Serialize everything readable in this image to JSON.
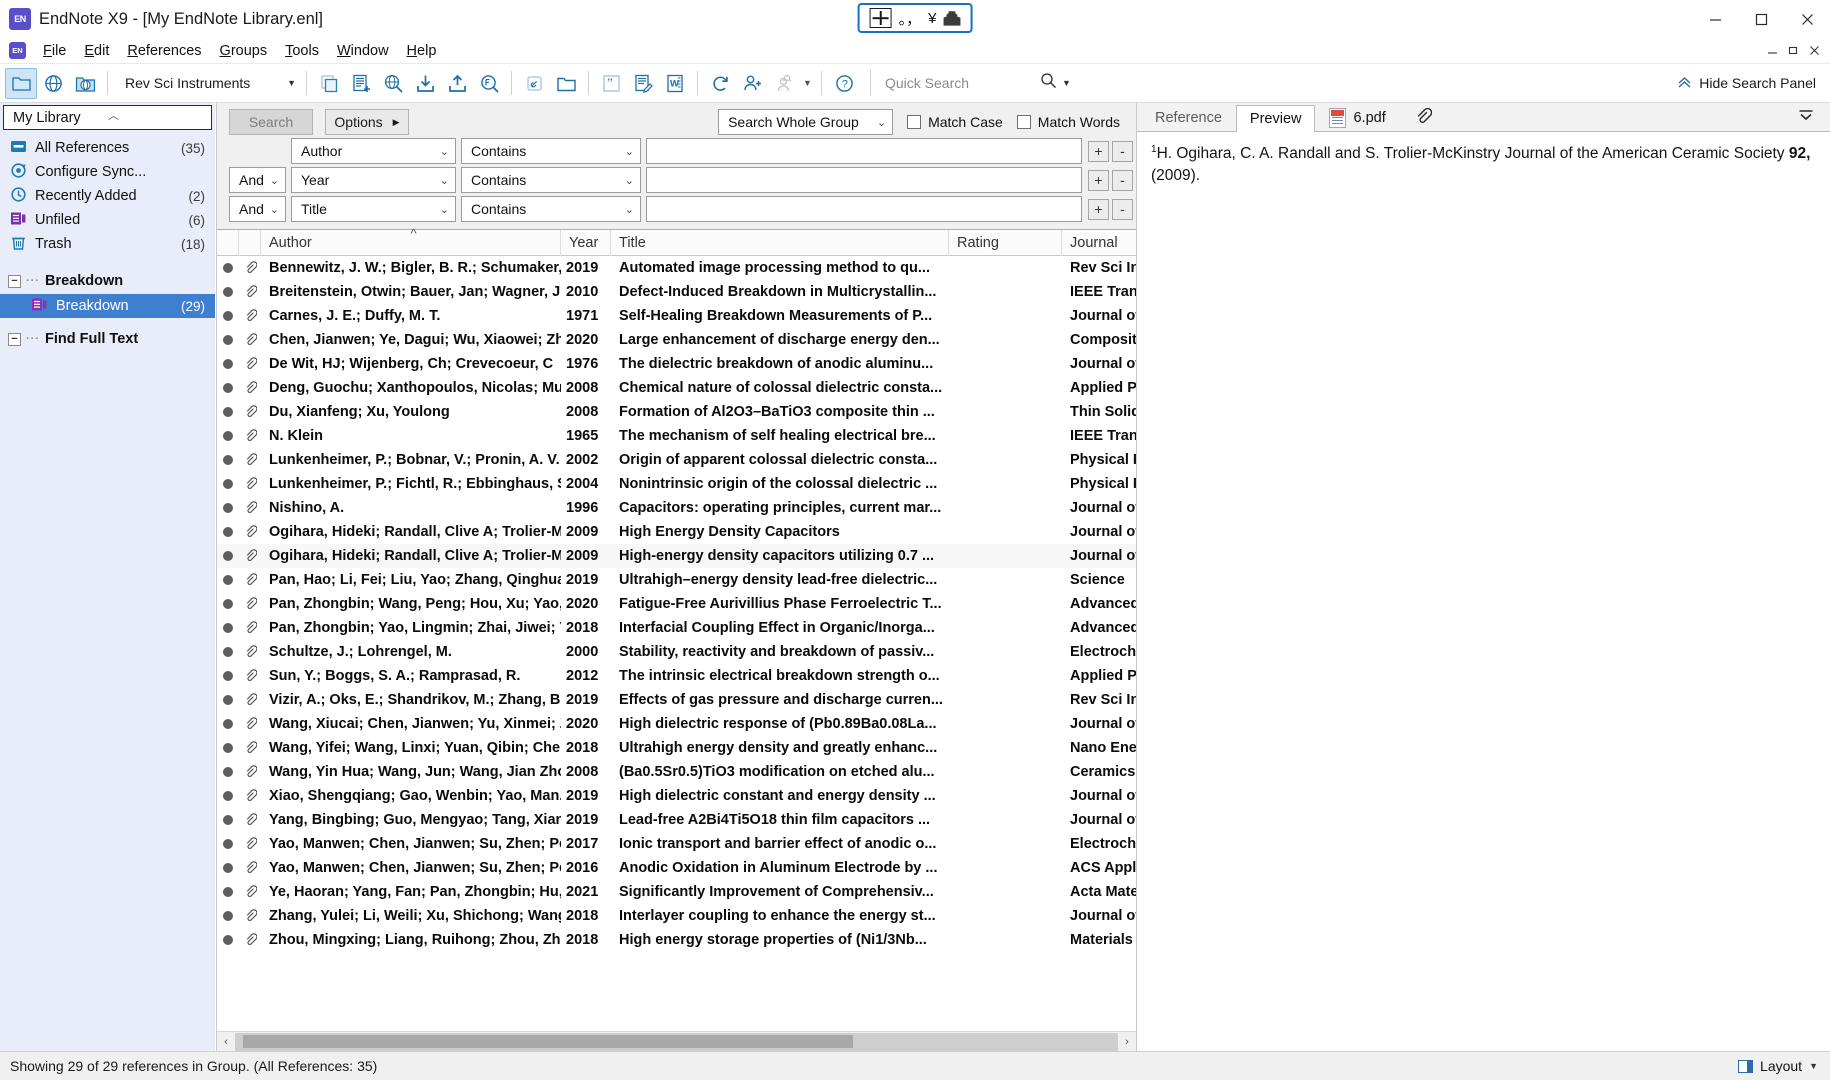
{
  "window": {
    "title": "EndNote X9 - [My EndNote Library.enl]",
    "app_badge": "EN",
    "minimize": "minimize",
    "maximize": "maximize",
    "close": "close"
  },
  "ime": {
    "lang": "中",
    "punct": "。，",
    "currency": "¥",
    "hat": "hat-icon"
  },
  "menu": {
    "items": [
      {
        "label": "File",
        "accel": "F"
      },
      {
        "label": "Edit",
        "accel": "E"
      },
      {
        "label": "References",
        "accel": "R"
      },
      {
        "label": "Groups",
        "accel": "G"
      },
      {
        "label": "Tools",
        "accel": "T"
      },
      {
        "label": "Window",
        "accel": "W"
      },
      {
        "label": "Help",
        "accel": "H"
      }
    ]
  },
  "toolbar": {
    "style_value": "Rev Sci Instruments",
    "quick_search_placeholder": "Quick Search",
    "hide_search_panel": "Hide Search Panel",
    "icons": [
      "new-folder-icon",
      "online-search-icon",
      "globe-folder-icon",
      "copy-icon",
      "new-reference-icon",
      "online-search-mode-icon",
      "import-icon",
      "export-icon",
      "find-full-text-icon",
      "link-icon",
      "open-file-icon",
      "quote-icon",
      "edit-reference-icon",
      "word-icon",
      "sync-icon",
      "share-icon",
      "activity-feed-icon",
      "help-icon"
    ]
  },
  "sidebar": {
    "library_label": "My Library",
    "items": [
      {
        "icon": "all-references-icon",
        "label": "All References",
        "count": "(35)"
      },
      {
        "icon": "configure-sync-icon",
        "label": "Configure Sync...",
        "count": ""
      },
      {
        "icon": "recently-added-icon",
        "label": "Recently Added",
        "count": "(2)"
      },
      {
        "icon": "unfiled-icon",
        "label": "Unfiled",
        "count": "(6)"
      },
      {
        "icon": "trash-icon",
        "label": "Trash",
        "count": "(18)"
      }
    ],
    "group_header": "Breakdown",
    "group_children": [
      {
        "icon": "group-icon",
        "label": "Breakdown",
        "count": "(29)",
        "selected": true
      }
    ],
    "find_full_text_header": "Find Full Text"
  },
  "search_panel": {
    "search_button": "Search",
    "options_button": "Options",
    "scope_value": "Search Whole Group",
    "match_case_label": "Match Case",
    "match_words_label": "Match Words",
    "match_case_checked": false,
    "match_words_checked": false,
    "rows": [
      {
        "conj": "",
        "field": "Author",
        "op": "Contains",
        "term": ""
      },
      {
        "conj": "And",
        "field": "Year",
        "op": "Contains",
        "term": ""
      },
      {
        "conj": "And",
        "field": "Title",
        "op": "Contains",
        "term": ""
      }
    ],
    "plus_label": "+",
    "minus_label": "-"
  },
  "table": {
    "columns": [
      "Author",
      "Year",
      "Title",
      "Rating",
      "Journal"
    ],
    "sorted_column": "Author",
    "rows": [
      {
        "author": "Bennewitz, J. W.; Bigler, B. R.; Schumaker, ...",
        "year": "2019",
        "title": "Automated image processing method to qu...",
        "rating": "",
        "journal": "Rev Sci Instrum"
      },
      {
        "author": "Breitenstein, Otwin; Bauer, Jan; Wagner, J...",
        "year": "2010",
        "title": "Defect-Induced Breakdown in Multicrystallin...",
        "rating": "",
        "journal": "IEEE Transactions on Elec"
      },
      {
        "author": "Carnes, J. E.; Duffy, M. T.",
        "year": "1971",
        "title": "Self-Healing Breakdown Measurements of P...",
        "rating": "",
        "journal": "Journal of Applied Physic"
      },
      {
        "author": "Chen, Jianwen; Ye, Dagui; Wu, Xiaowei; Zh...",
        "year": "2020",
        "title": "Large enhancement of discharge energy den...",
        "rating": "",
        "journal": "Composites Part A: Appl"
      },
      {
        "author": "De Wit, HJ; Wijenberg, Ch; Crevecoeur, C",
        "year": "1976",
        "title": "The dielectric breakdown of anodic aluminu...",
        "rating": "",
        "journal": "Journal of the Electroche"
      },
      {
        "author": "Deng, Guochu; Xanthopoulos, Nicolas; Mu...",
        "year": "2008",
        "title": "Chemical nature of colossal dielectric consta...",
        "rating": "",
        "journal": "Applied Physics Letters"
      },
      {
        "author": "Du, Xianfeng; Xu, Youlong",
        "year": "2008",
        "title": "Formation of Al2O3–BaTiO3 composite thin ...",
        "rating": "",
        "journal": "Thin Solid Films"
      },
      {
        "author": "N. Klein",
        "year": "1965",
        "title": "The mechanism of self healing electrical bre...",
        "rating": "",
        "journal": "IEEE Transactions on Elec"
      },
      {
        "author": "Lunkenheimer, P.; Bobnar, V.; Pronin, A. V.; ...",
        "year": "2002",
        "title": "Origin of apparent colossal dielectric consta...",
        "rating": "",
        "journal": "Physical Review B"
      },
      {
        "author": "Lunkenheimer, P.; Fichtl, R.; Ebbinghaus, S....",
        "year": "2004",
        "title": "Nonintrinsic origin of the colossal dielectric ...",
        "rating": "",
        "journal": "Physical Review B"
      },
      {
        "author": "Nishino, A.",
        "year": "1996",
        "title": "Capacitors: operating principles, current mar...",
        "rating": "",
        "journal": "Journal of Power Sources"
      },
      {
        "author": "Ogihara, Hideki; Randall, Clive A; Trolier-M...",
        "year": "2009",
        "title": "High Energy Density Capacitors",
        "rating": "",
        "journal": "Journal of the American"
      },
      {
        "author": "Ogihara, Hideki; Randall, Clive A; Trolier-M...",
        "year": "2009",
        "title": "High-energy density capacitors utilizing 0.7 ...",
        "rating": "",
        "journal": "Journal of the American",
        "selected": true
      },
      {
        "author": "Pan, Hao; Li, Fei; Liu, Yao; Zhang, Qinghua;...",
        "year": "2019",
        "title": "Ultrahigh–energy density lead-free dielectric...",
        "rating": "",
        "journal": "Science"
      },
      {
        "author": "Pan, Zhongbin; Wang, Peng; Hou, Xu; Yao, ...",
        "year": "2020",
        "title": "Fatigue-Free Aurivillius Phase Ferroelectric T...",
        "rating": "",
        "journal": "Advanced Energy Materi"
      },
      {
        "author": "Pan, Zhongbin; Yao, Lingmin; Zhai, Jiwei; Y...",
        "year": "2018",
        "title": "Interfacial Coupling Effect in Organic/Inorga...",
        "rating": "",
        "journal": "Advanced Materials"
      },
      {
        "author": "Schultze, J.; Lohrengel, M.",
        "year": "2000",
        "title": "Stability, reactivity and breakdown of passiv...",
        "rating": "",
        "journal": "Electrochimica Acta"
      },
      {
        "author": "Sun, Y.; Boggs, S. A.; Ramprasad, R.",
        "year": "2012",
        "title": "The intrinsic electrical breakdown strength o...",
        "rating": "",
        "journal": "Applied Physics Letters"
      },
      {
        "author": "Vizir, A.; Oks, E.; Shandrikov, M.; Zhang, B.;...",
        "year": "2019",
        "title": "Effects of gas pressure and discharge curren...",
        "rating": "",
        "journal": "Rev Sci Instrum"
      },
      {
        "author": "Wang, Xiucai; Chen, Jianwen; Yu, Xinmei; Z...",
        "year": "2020",
        "title": "High dielectric response of (Pb0.89Ba0.08La...",
        "rating": "",
        "journal": "Journal of Materials Scie"
      },
      {
        "author": "Wang, Yifei; Wang, Linxi; Yuan, Qibin; Che...",
        "year": "2018",
        "title": "Ultrahigh energy density and greatly enhanc...",
        "rating": "",
        "journal": "Nano Energy"
      },
      {
        "author": "Wang, Yin Hua; Wang, Jun; Wang, Jian Zho...",
        "year": "2008",
        "title": "(Ba0.5Sr0.5)TiO3 modification on etched alu...",
        "rating": "",
        "journal": "Ceramics International"
      },
      {
        "author": "Xiao, Shengqiang; Gao, Wenbin; Yao, Man...",
        "year": "2019",
        "title": "High dielectric constant and energy density ...",
        "rating": "",
        "journal": "Journal of Materials Cher"
      },
      {
        "author": "Yang, Bingbing; Guo, Mengyao; Tang, Xian...",
        "year": "2019",
        "title": "Lead-free A2Bi4Ti5O18 thin film capacitors ...",
        "rating": "",
        "journal": "Journal of Materials Cher"
      },
      {
        "author": "Yao, Manwen; Chen, Jianwen; Su, Zhen; Pe...",
        "year": "2017",
        "title": "Ionic transport and barrier effect of anodic o...",
        "rating": "",
        "journal": "Electrochimica Acta"
      },
      {
        "author": "Yao, Manwen; Chen, Jianwen; Su, Zhen; Pe...",
        "year": "2016",
        "title": "Anodic Oxidation in Aluminum Electrode by ...",
        "rating": "",
        "journal": "ACS Applied Materials &"
      },
      {
        "author": "Ye, Haoran; Yang, Fan; Pan, Zhongbin; Hu, ...",
        "year": "2021",
        "title": "Significantly Improvement of Comprehensiv...",
        "rating": "",
        "journal": "Acta Materialia"
      },
      {
        "author": "Zhang, Yulei; Li, Weili; Xu, Shichong; Wang...",
        "year": "2018",
        "title": "Interlayer coupling to enhance the energy st...",
        "rating": "",
        "journal": "Journal of Materials Cher"
      },
      {
        "author": "Zhou, Mingxing; Liang, Ruihong; Zhou, Zhi...",
        "year": "2018",
        "title": "High energy storage properties of (Ni1/3Nb...",
        "rating": "",
        "journal": "Materials Research Bulle"
      }
    ]
  },
  "preview": {
    "tabs": [
      {
        "label": "Reference",
        "active": false
      },
      {
        "label": "Preview",
        "active": true
      },
      {
        "label": "6.pdf",
        "active": false,
        "icon": "pdf-icon"
      }
    ],
    "attachment_icon": "paperclip-icon",
    "collapse_icon": "collapse-icon",
    "citation_sup": "1",
    "citation_before": "H. Ogihara, C. A. Randall and S. Trolier-McKinstry Journal of the American Ceramic Society ",
    "citation_bold": "92,",
    "citation_after": " (2009)."
  },
  "status": {
    "text": "Showing 29 of 29 references in Group. (All References: 35)",
    "layout_label": "Layout"
  }
}
